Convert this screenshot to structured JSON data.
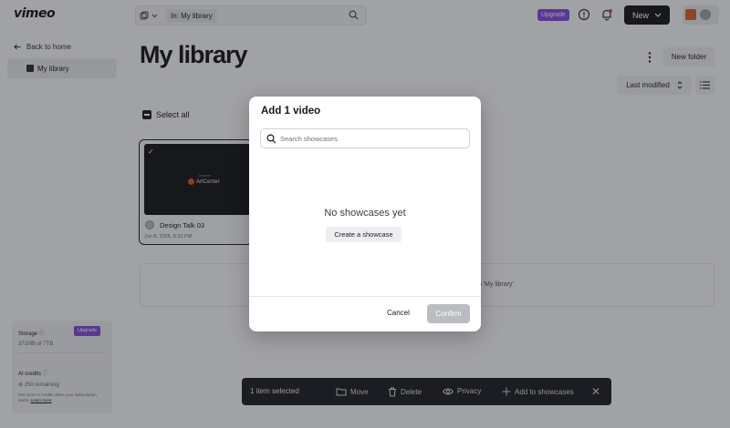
{
  "topbar": {
    "logo": "vimeo",
    "search_scope": "In: My library",
    "upgrade_label": "Upgrade",
    "new_label": "New"
  },
  "sidebar": {
    "back_label": "Back to home",
    "active_item": "My library",
    "storage": {
      "title": "Storage",
      "upgrade_label": "Upgrade",
      "used": "371MB of 7TB",
      "credits_title": "AI credits",
      "credits_remaining": "250 remaining",
      "note_prefix": "Get more AI credits when your subscription starts.",
      "note_link": "Learn more"
    }
  },
  "main": {
    "title": "My library",
    "new_folder_label": "New folder",
    "sort_label": "Last modified",
    "select_all_label": "Select all",
    "videos": [
      {
        "title": "Design Talk 03",
        "date": "Jun 8, 2025, 8:22 PM",
        "thumb_brand": "ArtCenter",
        "thumb_small": "museum"
      }
    ],
    "drop_text": "to 'My library'"
  },
  "action_bar": {
    "count_label": "1 item selected",
    "move_label": "Move",
    "delete_label": "Delete",
    "privacy_label": "Privacy",
    "add_label": "Add to showcases"
  },
  "modal": {
    "title": "Add 1 video",
    "search_placeholder": "Search showcases",
    "empty_title": "No showcases yet",
    "create_label": "Create a showcase",
    "cancel_label": "Cancel",
    "confirm_label": "Confirm"
  },
  "colors": {
    "accent_purple": "#7c4bd8",
    "dark": "#16181d",
    "confirm_disabled": "#b9bcc1"
  }
}
